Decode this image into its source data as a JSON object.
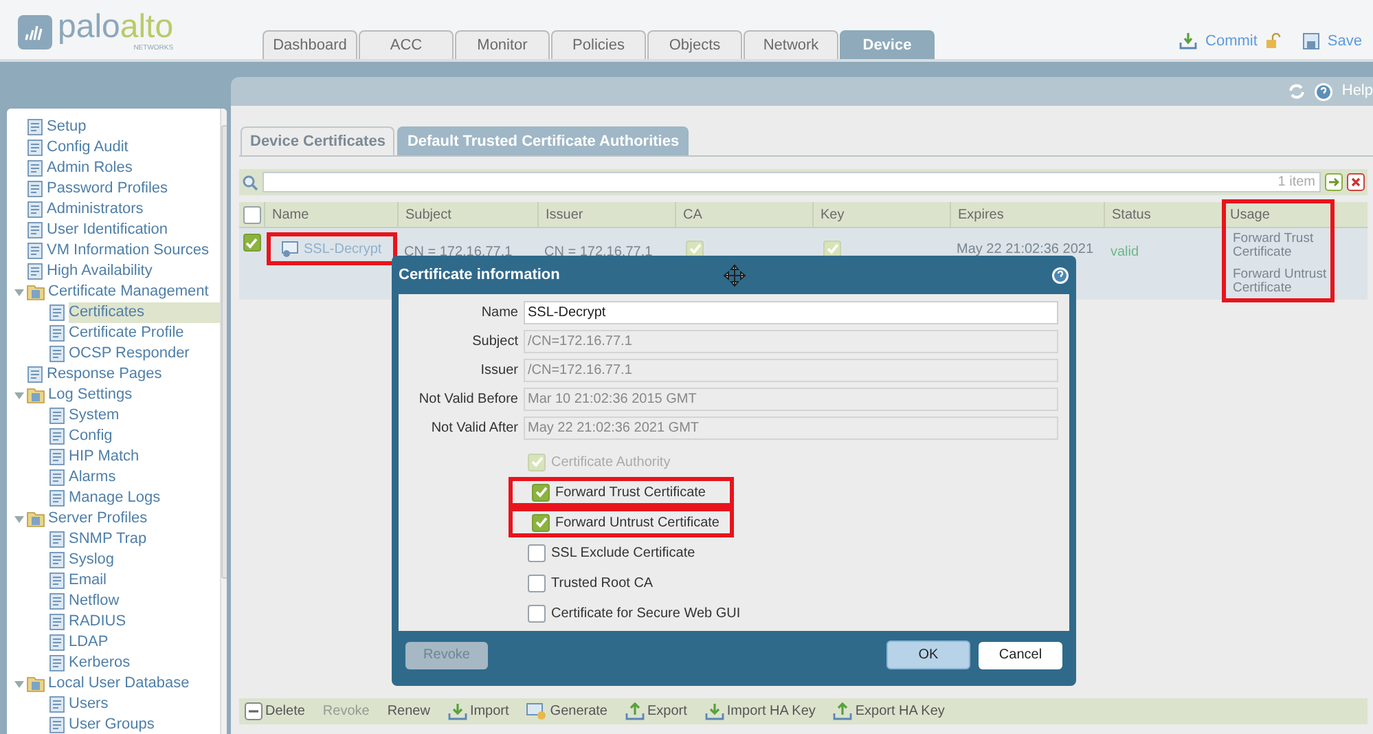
{
  "logo": {
    "word_1": "palo",
    "word_2": "alto",
    "subtitle": "NETWORKS"
  },
  "nav_tabs": [
    {
      "label": "Dashboard",
      "selected": false
    },
    {
      "label": "ACC",
      "selected": false
    },
    {
      "label": "Monitor",
      "selected": false
    },
    {
      "label": "Policies",
      "selected": false
    },
    {
      "label": "Objects",
      "selected": false
    },
    {
      "label": "Network",
      "selected": false
    },
    {
      "label": "Device",
      "selected": true
    }
  ],
  "header_actions": {
    "commit": "Commit",
    "save": "Save"
  },
  "help": "Help",
  "sidebar": {
    "items": [
      {
        "label": "Setup",
        "selected": false
      },
      {
        "label": "Config Audit",
        "selected": false
      },
      {
        "label": "Admin Roles",
        "selected": false
      },
      {
        "label": "Password Profiles",
        "selected": false
      },
      {
        "label": "Administrators",
        "selected": false
      },
      {
        "label": "User Identification",
        "selected": false
      },
      {
        "label": "VM Information Sources",
        "selected": false
      },
      {
        "label": "High Availability",
        "selected": false
      },
      {
        "label": "Certificate Management",
        "selected": false,
        "expanded": true,
        "children": [
          {
            "label": "Certificates",
            "selected": true
          },
          {
            "label": "Certificate Profile",
            "selected": false
          },
          {
            "label": "OCSP Responder",
            "selected": false
          }
        ]
      },
      {
        "label": "Response Pages",
        "selected": false
      },
      {
        "label": "Log Settings",
        "selected": false,
        "expanded": true,
        "children": [
          {
            "label": "System",
            "selected": false
          },
          {
            "label": "Config",
            "selected": false
          },
          {
            "label": "HIP Match",
            "selected": false
          },
          {
            "label": "Alarms",
            "selected": false
          },
          {
            "label": "Manage Logs",
            "selected": false
          }
        ]
      },
      {
        "label": "Server Profiles",
        "selected": false,
        "expanded": true,
        "children": [
          {
            "label": "SNMP Trap",
            "selected": false
          },
          {
            "label": "Syslog",
            "selected": false
          },
          {
            "label": "Email",
            "selected": false
          },
          {
            "label": "Netflow",
            "selected": false
          },
          {
            "label": "RADIUS",
            "selected": false
          },
          {
            "label": "LDAP",
            "selected": false
          },
          {
            "label": "Kerberos",
            "selected": false
          }
        ]
      },
      {
        "label": "Local User Database",
        "selected": false,
        "expanded": true,
        "children": [
          {
            "label": "Users",
            "selected": false
          },
          {
            "label": "User Groups",
            "selected": false
          }
        ]
      }
    ]
  },
  "sub_tabs": [
    {
      "label": "Device Certificates",
      "selected": true
    },
    {
      "label": "Default Trusted Certificate Authorities",
      "selected": false
    }
  ],
  "filter": {
    "count": "1 item"
  },
  "table": {
    "select_all": false,
    "columns": [
      {
        "label": "Name",
        "highlighted": false
      },
      {
        "label": "Subject",
        "highlighted": false
      },
      {
        "label": "Issuer",
        "highlighted": false
      },
      {
        "label": "CA",
        "highlighted": false
      },
      {
        "label": "Key",
        "highlighted": false
      },
      {
        "label": "Expires",
        "highlighted": false
      },
      {
        "label": "Status",
        "highlighted": false
      },
      {
        "label": "Usage",
        "highlighted": true
      }
    ],
    "rows": [
      {
        "selected": true,
        "name": "SSL-Decrypt",
        "name_highlighted": true,
        "subject": "CN = 172.16.77.1",
        "issuer": "CN = 172.16.77.1",
        "ca": true,
        "key": true,
        "expires": "May 22 21:02:36 2021",
        "status": "valid",
        "usage": [
          "Forward Trust Certificate",
          "Forward Untrust Certificate"
        ]
      }
    ]
  },
  "dialog": {
    "title": "Certificate information",
    "fields": [
      {
        "label": "Name",
        "value": "SSL-Decrypt",
        "disabled": false
      },
      {
        "label": "Subject",
        "value": "/CN=172.16.77.1",
        "disabled": true
      },
      {
        "label": "Issuer",
        "value": "/CN=172.16.77.1",
        "disabled": true
      },
      {
        "label": "Not Valid Before",
        "value": "Mar 10 21:02:36 2015 GMT",
        "disabled": true
      },
      {
        "label": "Not Valid After",
        "value": "May 22 21:02:36 2021 GMT",
        "disabled": true
      }
    ],
    "checkboxes": [
      {
        "label": "Certificate Authority",
        "checked": true,
        "disabled": true,
        "highlighted": false
      },
      {
        "label": "Forward Trust Certificate",
        "checked": true,
        "disabled": false,
        "highlighted": true
      },
      {
        "label": "Forward Untrust Certificate",
        "checked": true,
        "disabled": false,
        "highlighted": true
      },
      {
        "label": "SSL Exclude Certificate",
        "checked": false,
        "disabled": false,
        "highlighted": false
      },
      {
        "label": "Trusted Root CA",
        "checked": false,
        "disabled": false,
        "highlighted": false
      },
      {
        "label": "Certificate for Secure Web GUI",
        "checked": false,
        "disabled": false,
        "highlighted": false
      }
    ],
    "revoke": {
      "label": "Revoke",
      "disabled": true
    },
    "ok": "OK",
    "cancel": "Cancel"
  },
  "toolbar": [
    {
      "label": "Delete",
      "kind": "delete",
      "disabled": false
    },
    {
      "label": "Revoke",
      "kind": "plain",
      "disabled": true
    },
    {
      "label": "Renew",
      "kind": "plain",
      "disabled": false
    },
    {
      "label": "Import",
      "kind": "import",
      "disabled": false
    },
    {
      "label": "Generate",
      "kind": "generate",
      "disabled": false
    },
    {
      "label": "Export",
      "kind": "export",
      "disabled": false
    },
    {
      "label": "Import HA Key",
      "kind": "import",
      "disabled": false
    },
    {
      "label": "Export HA Key",
      "kind": "export",
      "disabled": false
    }
  ]
}
